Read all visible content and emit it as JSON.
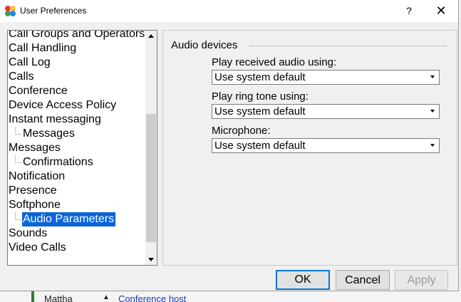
{
  "window": {
    "title": "User Preferences",
    "help_label": "?",
    "close_label": "✕"
  },
  "tree": {
    "items": [
      {
        "label": "Call Groups and Operators",
        "child": false
      },
      {
        "label": "Call Handling",
        "child": false
      },
      {
        "label": "Call Log",
        "child": false
      },
      {
        "label": "Calls",
        "child": false
      },
      {
        "label": "Conference",
        "child": false
      },
      {
        "label": "Device Access Policy",
        "child": false
      },
      {
        "label": "Instant messaging",
        "child": false
      },
      {
        "label": "Messages",
        "child": true
      },
      {
        "label": "Messages",
        "child": false
      },
      {
        "label": "Confirmations",
        "child": true
      },
      {
        "label": "Notification",
        "child": false
      },
      {
        "label": "Presence",
        "child": false
      },
      {
        "label": "Softphone",
        "child": false
      },
      {
        "label": "Audio Parameters",
        "child": true,
        "selected": true
      },
      {
        "label": "Sounds",
        "child": false
      },
      {
        "label": "Video Calls",
        "child": false
      }
    ]
  },
  "audio": {
    "group_title": "Audio devices",
    "received_label": "Play received audio using:",
    "received_value": "Use system default",
    "ringtone_label": "Play ring tone using:",
    "ringtone_value": "Use system default",
    "microphone_label": "Microphone:",
    "microphone_value": "Use system default"
  },
  "buttons": {
    "ok": "OK",
    "cancel": "Cancel",
    "apply": "Apply"
  },
  "background_app": {
    "text1": "Mattha",
    "text2": "Conference host"
  },
  "colors": {
    "selection": "#0a64d8",
    "default_button_border": "#0078d7"
  }
}
